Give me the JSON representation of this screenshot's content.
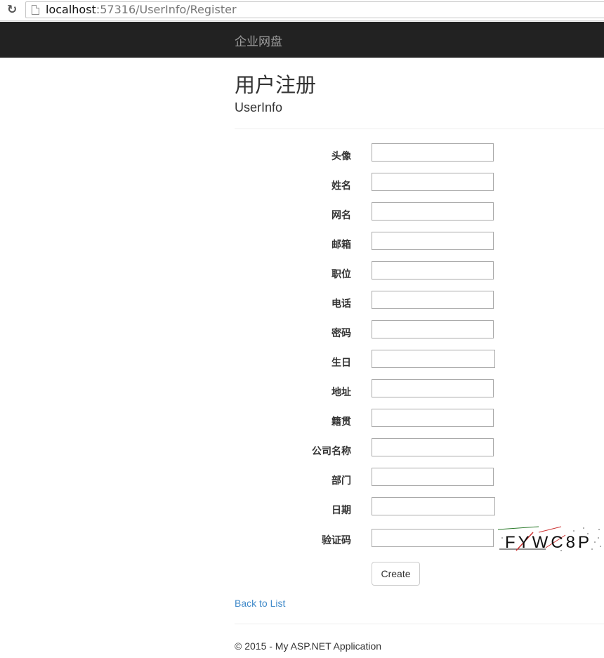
{
  "browser": {
    "url_host": "localhost",
    "url_path": ":57316/UserInfo/Register"
  },
  "navbar": {
    "brand": "企业网盘"
  },
  "page": {
    "title": "用户注册",
    "subtitle": "UserInfo"
  },
  "form": {
    "fields": [
      {
        "label": "头像",
        "value": ""
      },
      {
        "label": "姓名",
        "value": ""
      },
      {
        "label": "网名",
        "value": ""
      },
      {
        "label": "邮箱",
        "value": ""
      },
      {
        "label": "职位",
        "value": ""
      },
      {
        "label": "电话",
        "value": ""
      },
      {
        "label": "密码",
        "value": ""
      },
      {
        "label": "生日",
        "value": ""
      },
      {
        "label": "地址",
        "value": ""
      },
      {
        "label": "籍贯",
        "value": ""
      },
      {
        "label": "公司名称",
        "value": ""
      },
      {
        "label": "部门",
        "value": ""
      },
      {
        "label": "日期",
        "value": ""
      },
      {
        "label": "验证码",
        "value": ""
      }
    ],
    "captcha_text": "FYWC8P",
    "submit_label": "Create"
  },
  "links": {
    "back": "Back to List"
  },
  "footer": {
    "text": "© 2015 - My ASP.NET Application"
  },
  "colors": {
    "navbar_bg": "#222222",
    "brand": "#9d9d9d",
    "link": "#428bca"
  }
}
